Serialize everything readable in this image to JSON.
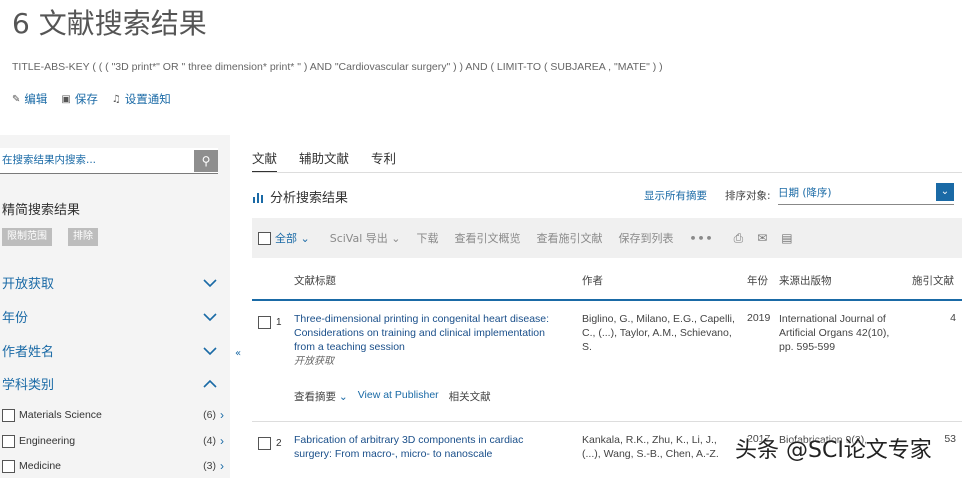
{
  "header": {
    "title": "6 文献搜索结果",
    "query": "TITLE-ABS-KEY ( ( ( \"3D print*\" OR \" three dimension* print* \" ) AND \"Cardiovascular surgery\" ) ) AND ( LIMIT-TO ( SUBJAREA , \"MATE\" ) )",
    "actions": [
      {
        "label": "编辑",
        "icon": "pencil-icon"
      },
      {
        "label": "保存",
        "icon": "save-icon"
      },
      {
        "label": "设置通知",
        "icon": "bell-icon"
      }
    ]
  },
  "sidebar": {
    "search_placeholder": "在搜索结果内搜索...",
    "refine_title": "精简搜索结果",
    "limit_label": "限制范围",
    "exclude_label": "排除",
    "facets": [
      {
        "label": "开放获取",
        "state": "collapsed"
      },
      {
        "label": "年份",
        "state": "collapsed"
      },
      {
        "label": "作者姓名",
        "state": "collapsed"
      },
      {
        "label": "学科类别",
        "state": "expanded"
      }
    ],
    "categories": [
      {
        "label": "Materials Science",
        "count": "(6)"
      },
      {
        "label": "Engineering",
        "count": "(4)"
      },
      {
        "label": "Medicine",
        "count": "(3)"
      }
    ]
  },
  "main": {
    "tabs": [
      {
        "label": "文献"
      },
      {
        "label": "辅助文献"
      },
      {
        "label": "专利"
      }
    ],
    "analyze_label": "分析搜索结果",
    "show_all_abstracts": "显示所有摘要",
    "sort_label": "排序对象:",
    "sort_value": "日期 (降序)",
    "toolbar": {
      "all": "全部",
      "scival": "SciVal 导出",
      "download": "下载",
      "citation_overview": "查看引文概览",
      "cited_by": "查看施引文献",
      "save_list": "保存到列表",
      "more": "•••"
    },
    "columns": {
      "title": "文献标题",
      "authors": "作者",
      "year": "年份",
      "source": "来源出版物",
      "cited": "施引文献"
    },
    "rows": [
      {
        "num": "1",
        "title": "Three-dimensional printing in congenital heart disease: Considerations on training and clinical implementation from a teaching session",
        "oa": "开放获取",
        "authors": "Biglino, G., Milano, E.G., Capelli, C., (...), Taylor, A.M., Schievano, S.",
        "year": "2019",
        "source": "International Journal of Artificial Organs 42(10), pp. 595-599",
        "cited": "4",
        "view_abstract": "查看摘要",
        "view_publisher": "View at Publisher",
        "related": "相关文献"
      },
      {
        "num": "2",
        "title": "Fabrication of arbitrary 3D components in cardiac surgery: From macro-, micro- to nanoscale",
        "oa": "",
        "authors": "Kankala, R.K., Zhu, K., Li, J., (...), Wang, S.-B., Chen, A.-Z.",
        "year": "2017",
        "source": "Biofabrication 9(3),",
        "cited": "53"
      }
    ]
  },
  "watermark": "头条 @SCI论文专家"
}
